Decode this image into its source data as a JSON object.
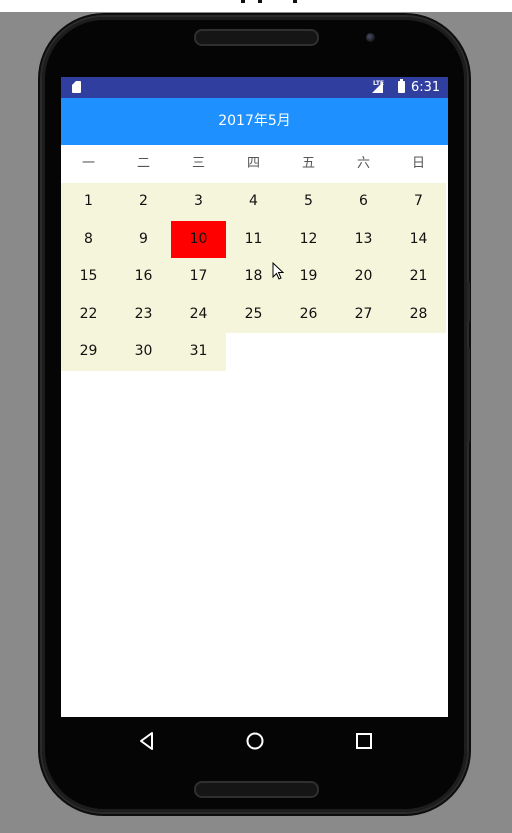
{
  "status_bar": {
    "network": "LTE",
    "time": "6:31"
  },
  "header": {
    "title": "2017年5月"
  },
  "weekdays": [
    "一",
    "二",
    "三",
    "四",
    "五",
    "六",
    "日"
  ],
  "days": [
    "1",
    "2",
    "3",
    "4",
    "5",
    "6",
    "7",
    "8",
    "9",
    "10",
    "11",
    "12",
    "13",
    "14",
    "15",
    "16",
    "17",
    "18",
    "19",
    "20",
    "21",
    "22",
    "23",
    "24",
    "25",
    "26",
    "27",
    "28",
    "29",
    "30",
    "31"
  ],
  "selected_day": "10",
  "colors": {
    "status_bar": "#303f9f",
    "header": "#1e90ff",
    "day_cell": "#f5f5dc",
    "selected_day": "#ff0000"
  },
  "nav_icons": [
    "back-icon",
    "home-icon",
    "recents-icon"
  ]
}
